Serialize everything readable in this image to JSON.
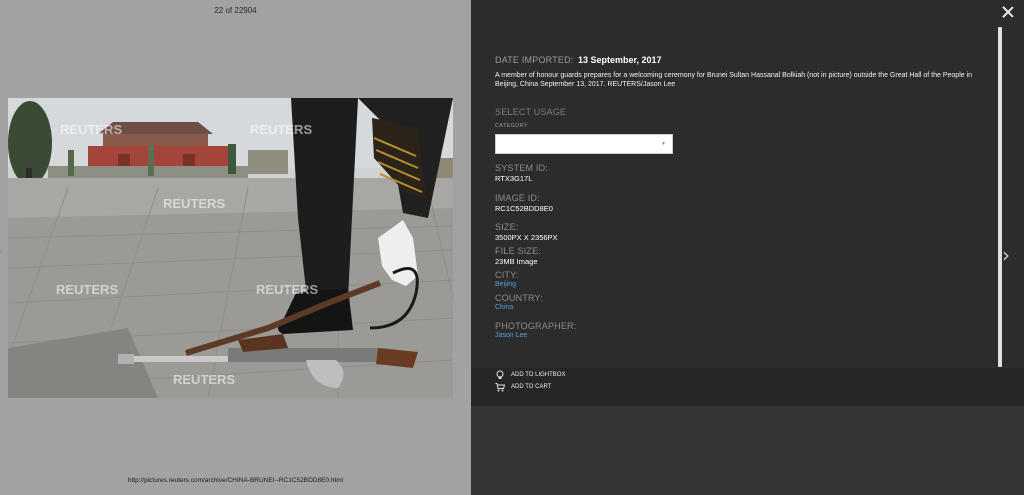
{
  "viewer": {
    "counter": "22 of 22904",
    "photo_url": "http://pictures.reuters.com/archive/CHINA-BRUNEI--RC1C52BDD8E0.html",
    "watermark": "REUTERS"
  },
  "details": {
    "date_imported_label": "DATE IMPORTED:",
    "date_imported_value": "13 September, 2017",
    "caption": "A member of honour guards prepares for a welcoming ceremony for Brunei Sultan Hassanal Bolkiah (not in picture) outside the Great Hall of the People in Beijing, China September 13, 2017. REUTERS/Jason Lee",
    "select_usage_label": "SELECT USAGE",
    "category_label": "CATEGORY",
    "category_value": "",
    "system_id_label": "SYSTEM ID:",
    "system_id_value": "RTX3G17L",
    "image_id_label": "IMAGE ID:",
    "image_id_value": "RC1C52BDD8E0",
    "size_label": "SIZE:",
    "size_value": "3500PX X 2356PX",
    "file_size_label": "FILE SIZE:",
    "file_size_value": "23MB Image",
    "city_label": "CITY:",
    "city_value": "Beijing",
    "country_label": "COUNTRY:",
    "country_value": "China",
    "photographer_label": "PHOTOGRAPHER:",
    "photographer_value": "Jason Lee"
  },
  "actions": {
    "lightbox_label": "ADD TO LIGHTBOX",
    "lightbox_icon": "lightbulb-icon",
    "cart_label": "ADD TO CART",
    "cart_icon": "cart-icon"
  },
  "nav": {
    "close_icon": "close-icon",
    "next_icon": "chevron-right-icon"
  },
  "colors": {
    "panel_bg": "#2c2c2c",
    "link": "#5a9fd8",
    "viewer_bg": "#a2a2a2"
  }
}
